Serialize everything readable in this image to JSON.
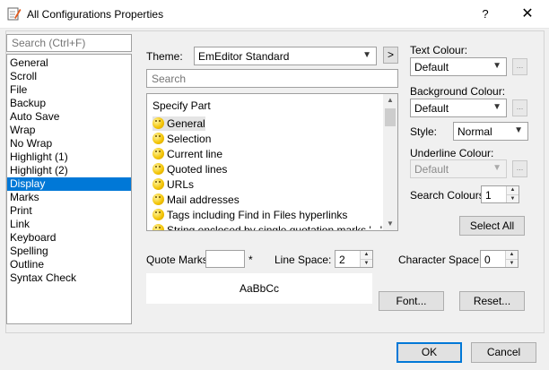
{
  "window": {
    "title": "All Configurations Properties",
    "help": "?",
    "close": "✕"
  },
  "search": {
    "placeholder": "Search (Ctrl+F)"
  },
  "categories": [
    "General",
    "Scroll",
    "File",
    "Backup",
    "Auto Save",
    "Wrap",
    "No Wrap",
    "Highlight (1)",
    "Highlight (2)",
    "Display",
    "Marks",
    "Print",
    "Link",
    "Keyboard",
    "Spelling",
    "Outline",
    "Syntax Check"
  ],
  "selected_category": "Display",
  "theme": {
    "label": "Theme:",
    "value": "EmEditor Standard",
    "arrow_btn": ">"
  },
  "parts": {
    "search_placeholder": "Search",
    "header": "Specify Part",
    "items": [
      "General",
      "Selection",
      "Current line",
      "Quoted lines",
      "URLs",
      "Mail addresses",
      "Tags including Find in Files hyperlinks",
      "String enclosed by single quotation marks '...'"
    ]
  },
  "colours": {
    "text_label": "Text Colour:",
    "text_value": "Default",
    "background_label": "Background Colour:",
    "background_value": "Default",
    "style_label": "Style:",
    "style_value": "Normal",
    "underline_label": "Underline Colour:",
    "underline_value": "Default",
    "dots": "..."
  },
  "search_colours": {
    "label": "Search Colours:",
    "value": "1"
  },
  "select_all": "Select All",
  "quote_marks": {
    "label": "Quote Marks:",
    "value": "",
    "star": "*"
  },
  "line_space": {
    "label": "Line Space:",
    "value": "2"
  },
  "character_space": {
    "label": "Character Space:",
    "value": "0"
  },
  "preview": "AaBbCc",
  "font_btn": "Font...",
  "reset_btn": "Reset...",
  "ok_btn": "OK",
  "cancel_btn": "Cancel",
  "accent": "#0078d7"
}
